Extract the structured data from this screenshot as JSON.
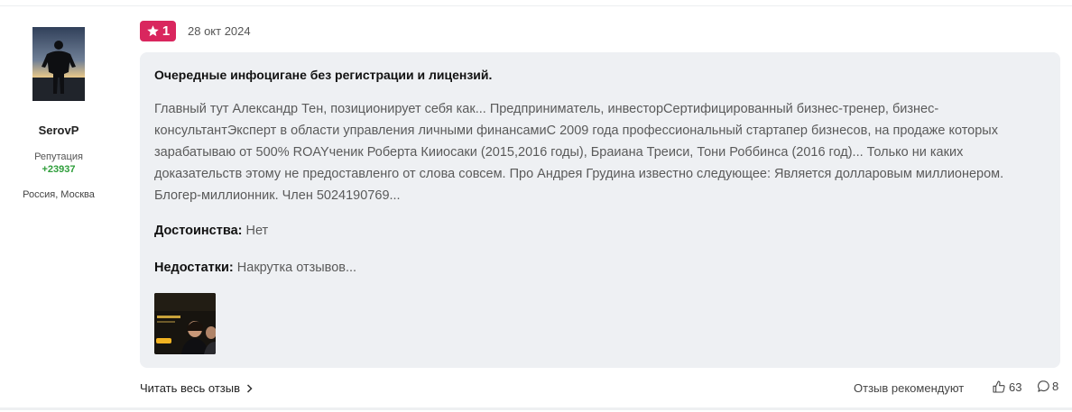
{
  "author": {
    "name": "SerovP",
    "reputation_label": "Репутация",
    "reputation_value": "+23937",
    "location": "Россия, Москва"
  },
  "review": {
    "rating": "1",
    "date": "28 окт 2024",
    "title": "Очередные инфоцигане без регистрации и лицензий.",
    "text": "Главный тут Александр Тен, позиционирует себя как... Предприниматель, инвесторСертифицированный бизнес-тренер, бизнес-консультантЭксперт в области управления личными финансамиС 2009 года профессиональный стартапер бизнесов, на продаже которых зарабатываю от 500% ROAYченик Роберта Кииосаки (2015,2016 годы), Браиана Треиси, Тони Роббинса (2016 год)... Только ни каких доказательств этому не предоставленго от слова совсем. Про Андрея Грудина известно следующее: Является долларовым миллионером. Блогер-миллионник. Член 5024190769...",
    "pros_label": "Достоинства:",
    "pros_value": " Нет",
    "cons_label": "Недостатки:",
    "cons_value": " Накрутка отзывов..."
  },
  "footer": {
    "read_more": "Читать весь отзыв",
    "recommends": "Отзыв рекомендуют",
    "likes": "63",
    "comments": "8"
  },
  "colors": {
    "badge": "#d9265e",
    "reputation": "#2e9e3a",
    "card_background": "#eef0f3"
  },
  "icons": [
    "star-icon",
    "chevron-right-icon",
    "thumbs-up-icon",
    "comment-icon"
  ]
}
